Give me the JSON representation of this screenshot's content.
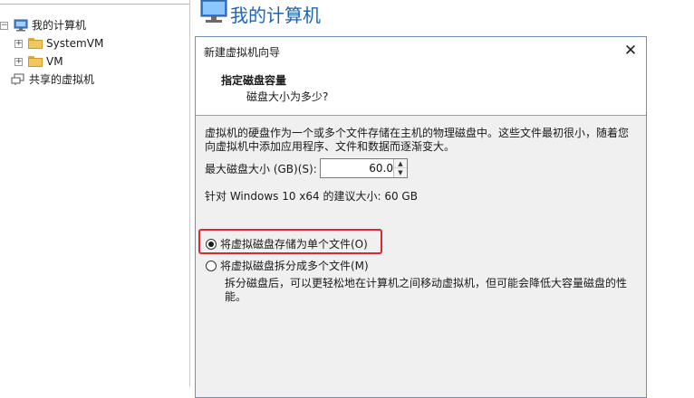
{
  "tree": {
    "root_label": "我的计算机",
    "items": [
      {
        "label": "SystemVM"
      },
      {
        "label": "VM"
      }
    ],
    "shared_label": "共享的虚拟机"
  },
  "header": {
    "title": "我的计算机"
  },
  "dialog": {
    "title": "新建虚拟机向导",
    "step_title": "指定磁盘容量",
    "step_subtitle": "磁盘大小为多少?",
    "description": "虚拟机的硬盘作为一个或多个文件存储在主机的物理磁盘中。这些文件最初很小，随着您向虚拟机中添加应用程序、文件和数据而逐渐变大。",
    "max_size_label": "最大磁盘大小 (GB)(S):",
    "max_size_value": "60.0",
    "recommend_text": "针对 Windows 10 x64 的建议大小: 60 GB",
    "option_single": "将虚拟磁盘存储为单个文件(O)",
    "option_split": "将虚拟磁盘拆分成多个文件(M)",
    "split_note": "拆分磁盘后，可以更轻松地在计算机之间移动虚拟机，但可能会降低大容量磁盘的性能。",
    "selected_option": "single"
  },
  "colors": {
    "header_title": "#1c64b8",
    "highlight": "#e0262e",
    "dialog_border": "#6f90b8"
  }
}
